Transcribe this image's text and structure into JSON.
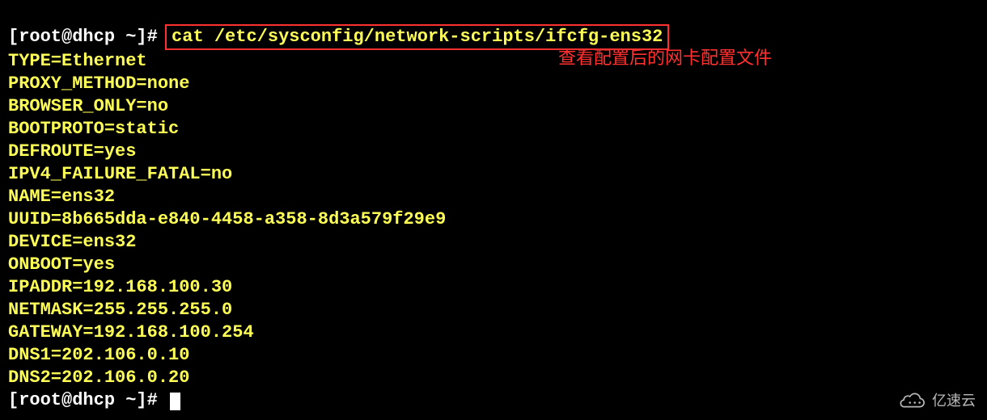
{
  "prompt1_user": "[root@dhcp ~]#",
  "command": "cat /etc/sysconfig/network-scripts/ifcfg-ens32",
  "annotation": "查看配置后的网卡配置文件",
  "file_lines": [
    "TYPE=Ethernet",
    "PROXY_METHOD=none",
    "BROWSER_ONLY=no",
    "BOOTPROTO=static",
    "DEFROUTE=yes",
    "IPV4_FAILURE_FATAL=no",
    "NAME=ens32",
    "UUID=8b665dda-e840-4458-a358-8d3a579f29e9",
    "DEVICE=ens32",
    "ONBOOT=yes",
    "IPADDR=192.168.100.30",
    "NETMASK=255.255.255.0",
    "GATEWAY=192.168.100.254",
    "DNS1=202.106.0.10",
    "DNS2=202.106.0.20"
  ],
  "prompt2_user": "[root@dhcp ~]#",
  "watermark_text": "亿速云"
}
